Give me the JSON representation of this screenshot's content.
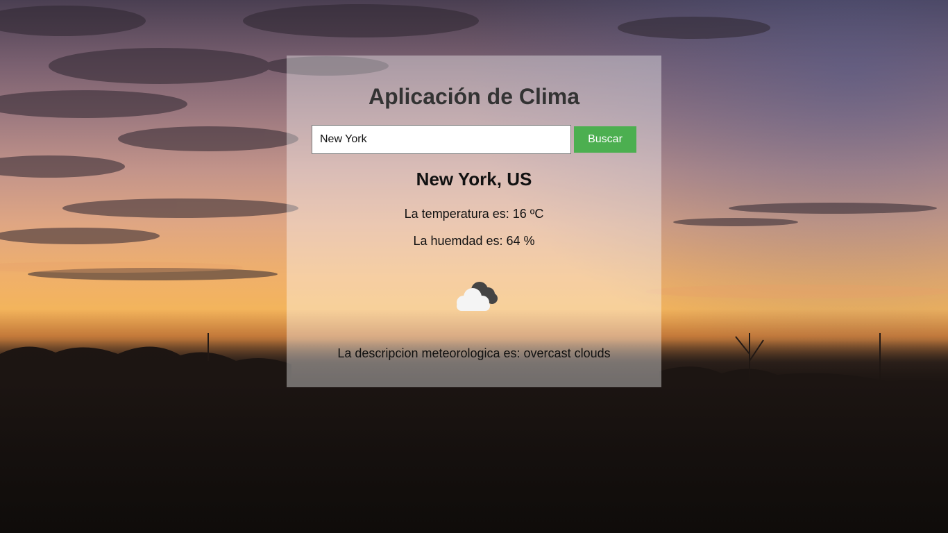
{
  "app": {
    "title": "Aplicación de Clima"
  },
  "search": {
    "value": "New York",
    "button_label": "Buscar"
  },
  "weather": {
    "location": "New York, US",
    "temperature_text": "La temperatura es: 16 ºC",
    "humidity_text": "La huemdad es: 64 %",
    "description_text": "La descripcion meteorologica es: overcast clouds",
    "icon": "overcast-clouds-icon"
  },
  "colors": {
    "accent": "#4caf50",
    "title": "#333333"
  }
}
